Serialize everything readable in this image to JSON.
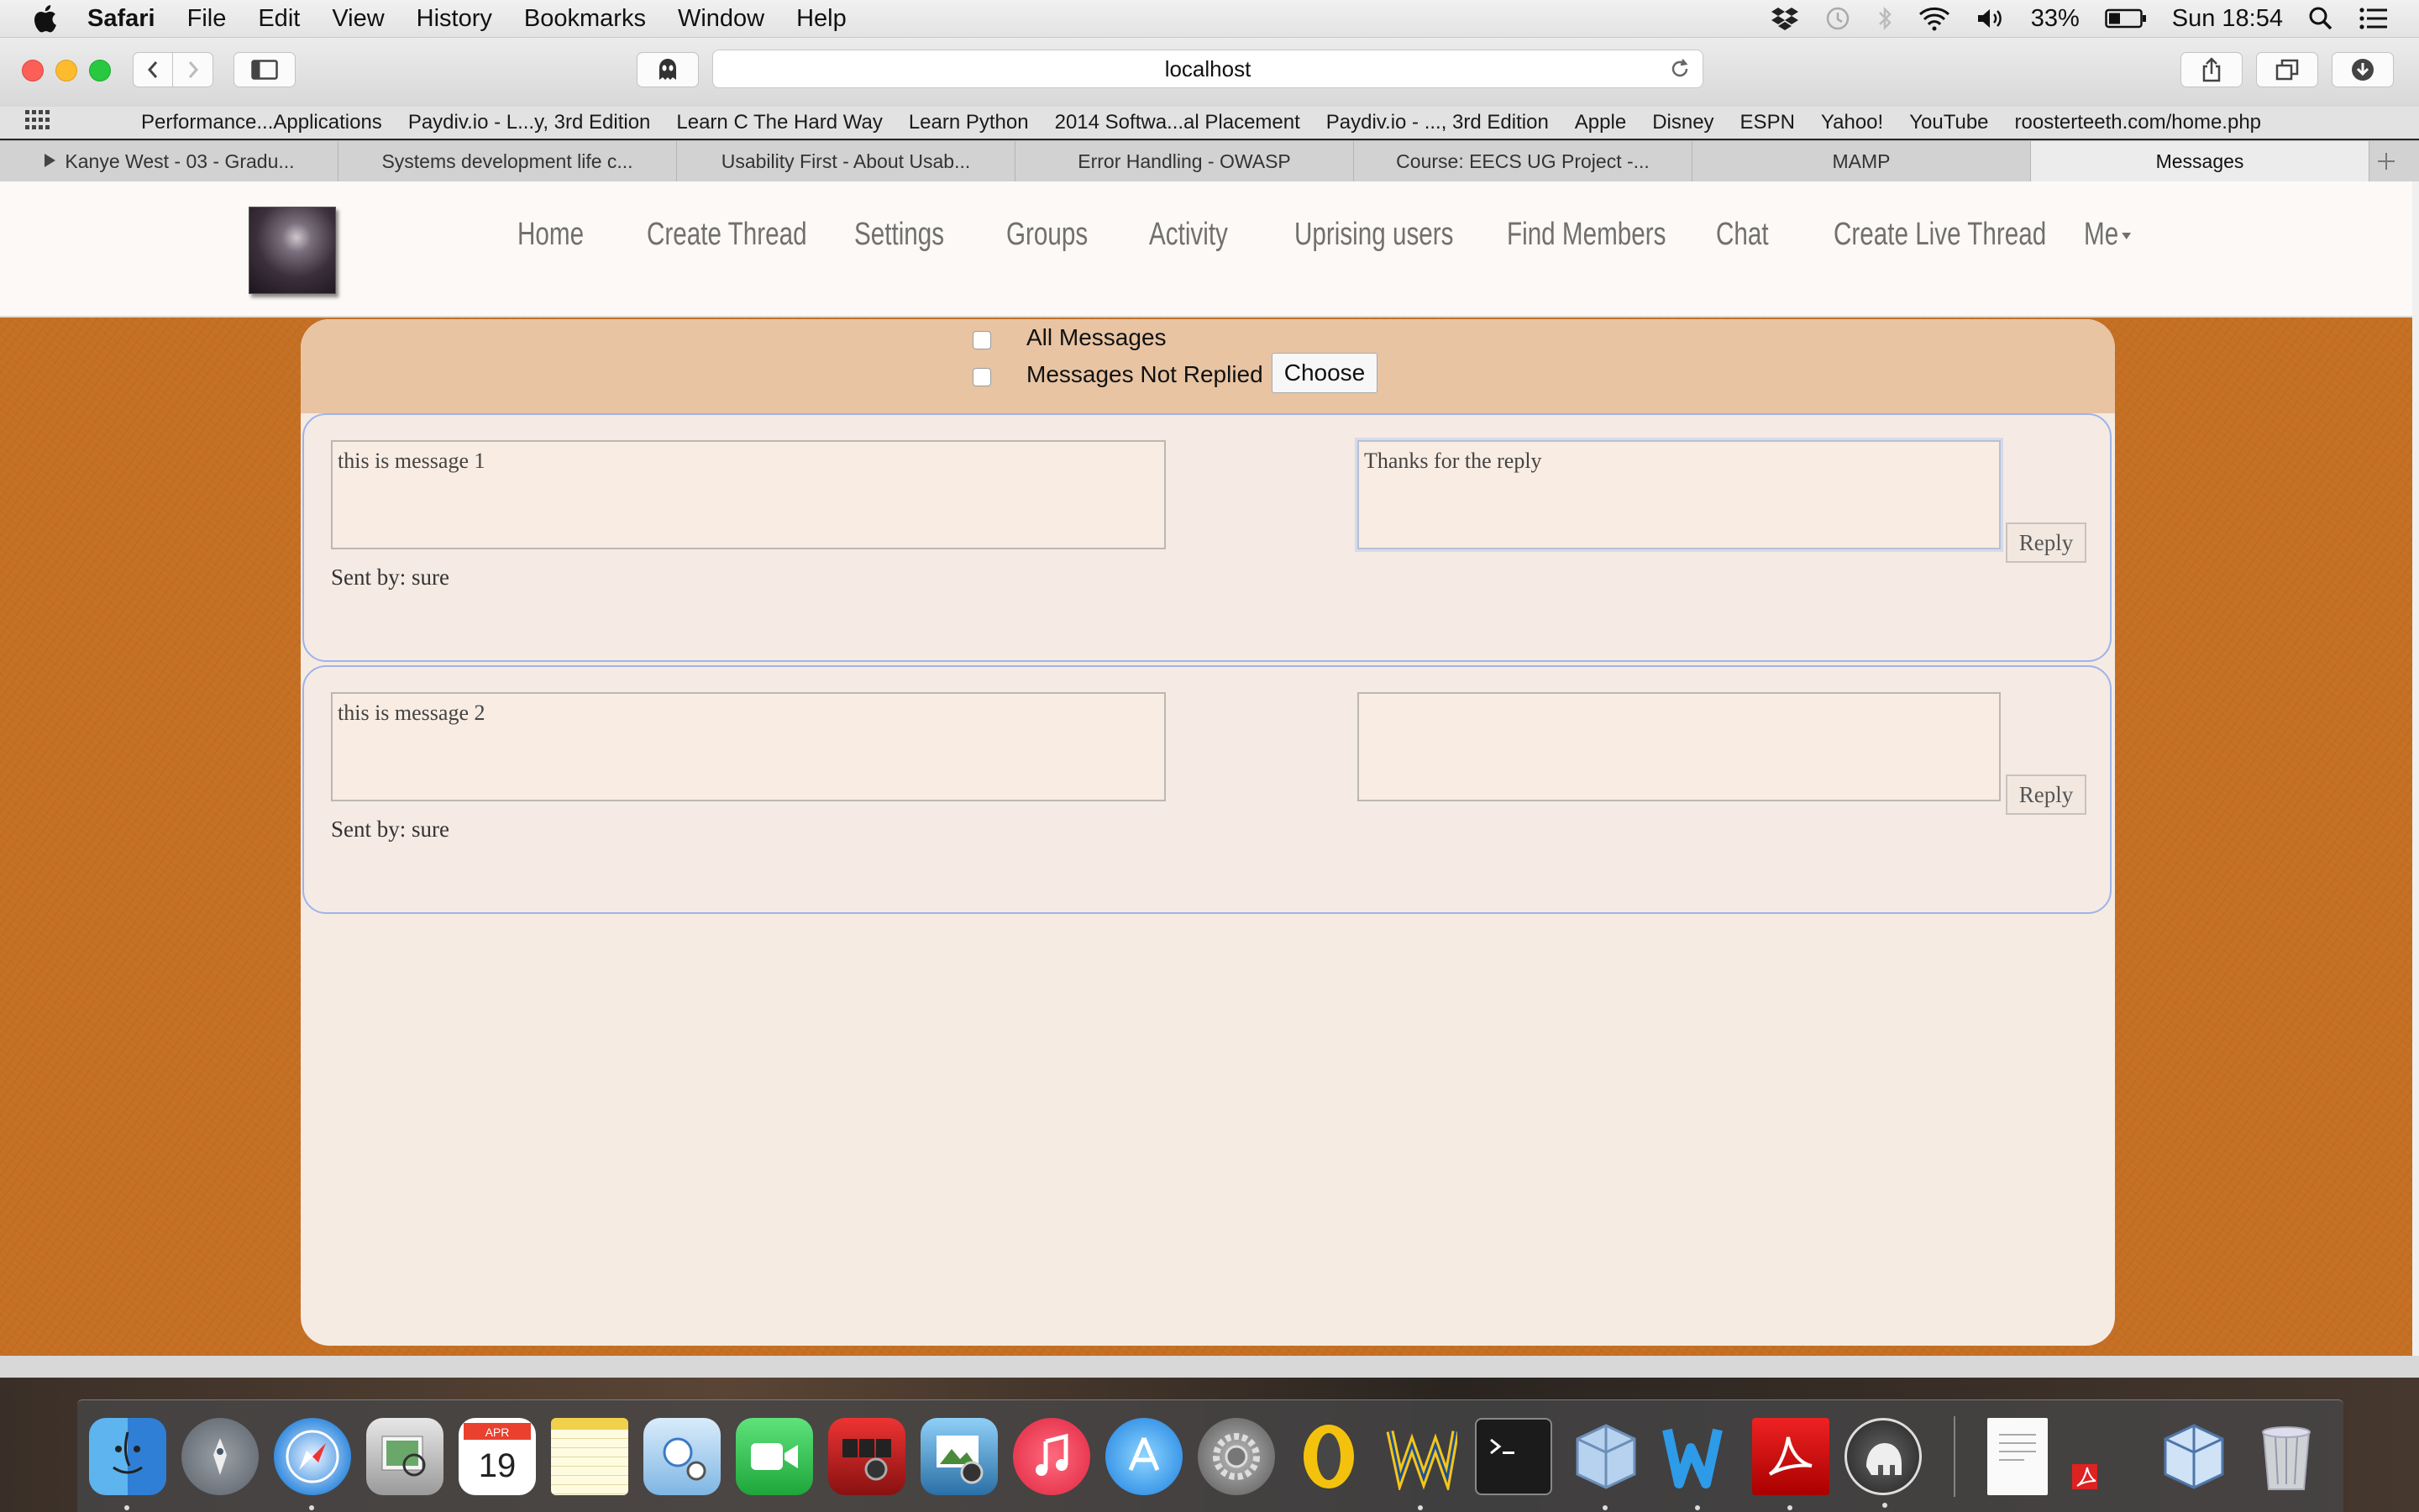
{
  "menubar": {
    "app": "Safari",
    "items": [
      "File",
      "Edit",
      "View",
      "History",
      "Bookmarks",
      "Window",
      "Help"
    ],
    "battery": "33%",
    "clock": "Sun 18:54"
  },
  "toolbar": {
    "url": "localhost"
  },
  "favorites": [
    "Performance...Applications",
    "Paydiv.io - L...y, 3rd Edition",
    "Learn C The Hard Way",
    "Learn Python",
    "2014 Softwa...al Placement",
    "Paydiv.io - ..., 3rd Edition",
    "Apple",
    "Disney",
    "ESPN",
    "Yahoo!",
    "YouTube",
    "roosterteeth.com/home.php"
  ],
  "tabs": [
    {
      "label": "Kanye West - 03 - Gradu...",
      "playing": true
    },
    {
      "label": "Systems development life c..."
    },
    {
      "label": "Usability First - About Usab..."
    },
    {
      "label": "Error Handling - OWASP"
    },
    {
      "label": "Course: EECS UG Project -..."
    },
    {
      "label": "MAMP"
    },
    {
      "label": "Messages",
      "active": true
    }
  ],
  "site_nav": {
    "links": [
      "Home",
      "Create Thread",
      "Settings",
      "Groups",
      "Activity",
      "Uprising users",
      "Find Members",
      "Chat",
      "Create Live Thread",
      "Me"
    ]
  },
  "filter": {
    "all_messages": "All Messages",
    "not_replied": "Messages Not Replied",
    "choose": "Choose"
  },
  "messages": [
    {
      "text": "this is message 1",
      "sent_by": "Sent by: sure",
      "reply": "Thanks for the reply",
      "reply_button": "Reply"
    },
    {
      "text": "this is message 2",
      "sent_by": "Sent by: sure",
      "reply": "",
      "reply_button": "Reply"
    }
  ],
  "dock": {
    "calendar_month": "APR",
    "calendar_day": "19",
    "apps": [
      "finder-icon",
      "launchpad-icon",
      "safari-icon",
      "preview-icon",
      "calendar-icon",
      "notes-icon",
      "photo-booth-icon",
      "facetime-icon",
      "photo-booth-strip-icon",
      "iphoto-icon",
      "itunes-icon",
      "app-store-icon",
      "system-preferences-icon",
      "opera-icon",
      "wampserver-icon",
      "terminal-icon",
      "virtualbox-icon",
      "word-icon",
      "acrobat-icon",
      "sequel-icon",
      "document-icon",
      "virtualbox-file-icon",
      "trash-icon"
    ]
  },
  "colors": {
    "page_background": "#c56f23",
    "panel": "#f6ebe3",
    "filter_band": "#e8c4a3",
    "card_border": "#9fb3e8",
    "nav_text": "#707070"
  }
}
